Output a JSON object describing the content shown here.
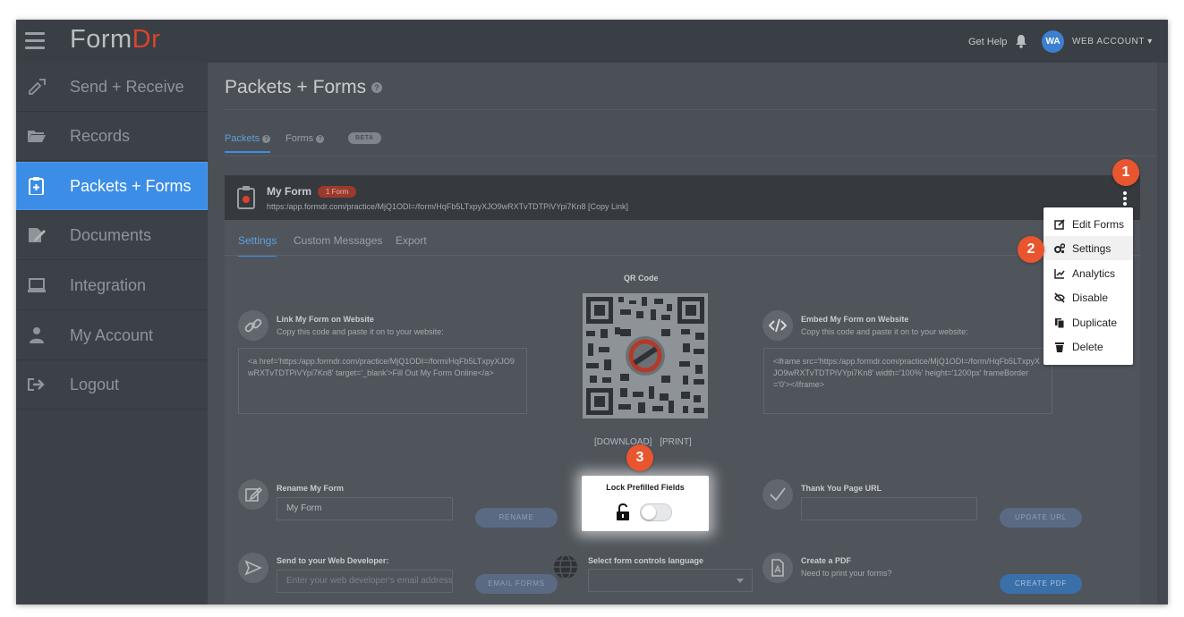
{
  "topbar": {
    "logo_main": "Form",
    "logo_accent": "Dr",
    "get_help": "Get Help",
    "avatar_initials": "WA",
    "account_label": "WEB ACCOUNT ▾"
  },
  "sidebar": {
    "items": [
      {
        "label": "Send + Receive",
        "icon": "pencil-arrows-icon"
      },
      {
        "label": "Records",
        "icon": "folder-open-icon"
      },
      {
        "label": "Packets + Forms",
        "icon": "clipboard-plus-icon",
        "active": true
      },
      {
        "label": "Documents",
        "icon": "edit-document-icon"
      },
      {
        "label": "Integration",
        "icon": "laptop-icon"
      },
      {
        "label": "My Account",
        "icon": "user-icon"
      },
      {
        "label": "Logout",
        "icon": "sign-out-icon"
      }
    ]
  },
  "main": {
    "title": "Packets + Forms",
    "tabs": {
      "packets": "Packets",
      "forms": "Forms",
      "beta": "BETA"
    }
  },
  "card": {
    "form_name": "My Form",
    "form_badge": "1 Form",
    "form_url": "https:/app.formdr.com/practice/MjQ1ODI=/form/HqFb5LTxpyXJO9wRXTvTDTPiVYpi7Kn8   [Copy Link]",
    "tabs": [
      "Settings",
      "Custom Messages",
      "Export"
    ],
    "qr": {
      "label": "QR Code",
      "download": "[DOWNLOAD]",
      "print": "[PRINT]"
    },
    "link_section": {
      "title": "Link My Form on Website",
      "subtitle": "Copy this code and paste it on to your website:",
      "code": "<a href='https:/app.formdr.com/practice/MjQ1ODI=/form/HqFb5LTxpyXJO9wRXTvTDTPiVYpi7Kn8' target='_blank'>Fill Out My Form Online</a>"
    },
    "embed_section": {
      "title": "Embed My Form on Website",
      "subtitle": "Copy this code and paste it on to your website:",
      "code": "<iframe src='https:/app.formdr.com/practice/MjQ1ODI=/form/HqFb5LTxpyXJO9wRXTvTDTPiVYpi7Kn8' width='100%' height='1200px' frameBorder='0'></iframe>"
    },
    "rename": {
      "title": "Rename My Form",
      "value": "My Form",
      "button": "RENAME"
    },
    "lock": {
      "title": "Lock Prefilled Fields",
      "enabled": false
    },
    "thankyou": {
      "title": "Thank You Page URL",
      "value": "",
      "button": "UPDATE URL"
    },
    "developer": {
      "title": "Send to your Web Developer:",
      "placeholder": "Enter your web developer's email address",
      "button": "EMAIL FORMS"
    },
    "language": {
      "title": "Select form controls language",
      "value": ""
    },
    "pdf": {
      "title": "Create a PDF",
      "subtitle": "Need to print your forms?",
      "button": "CREATE PDF"
    }
  },
  "menu": {
    "items": [
      {
        "label": "Edit Forms",
        "icon": "edit-icon"
      },
      {
        "label": "Settings",
        "icon": "gears-icon",
        "highlighted": true
      },
      {
        "label": "Analytics",
        "icon": "chart-line-icon"
      },
      {
        "label": "Disable",
        "icon": "eye-slash-icon"
      },
      {
        "label": "Duplicate",
        "icon": "copy-icon"
      },
      {
        "label": "Delete",
        "icon": "trash-icon"
      }
    ]
  },
  "callouts": [
    "1",
    "2",
    "3"
  ],
  "colors": {
    "accent": "#3b8de6",
    "brand": "#d9442c",
    "callout": "#e9552f"
  }
}
